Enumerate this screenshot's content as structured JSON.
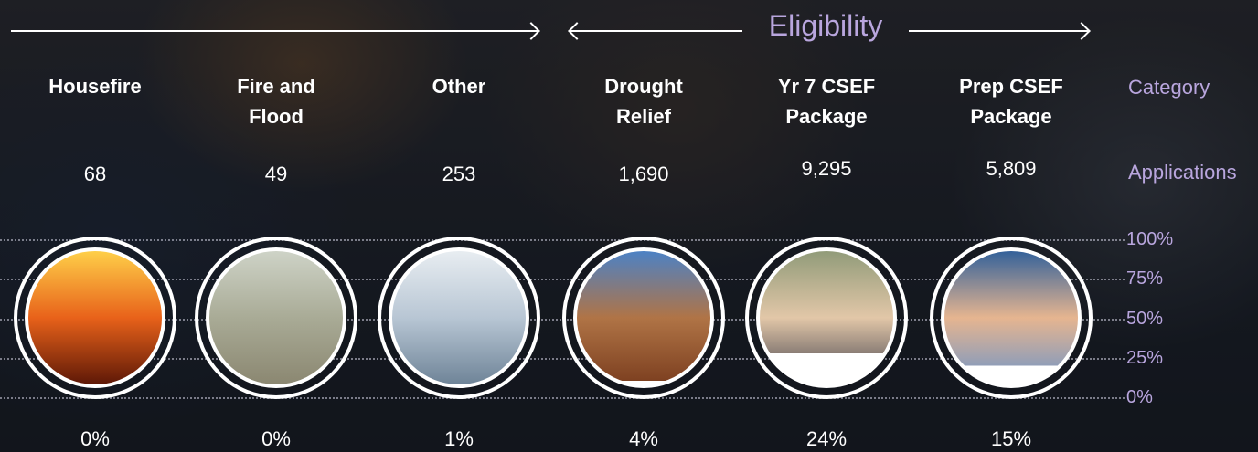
{
  "header": {
    "eligibility_label": "Eligibility"
  },
  "row_labels": {
    "category": "Category",
    "applications": "Applications"
  },
  "colors": {
    "accent": "#b9a6de",
    "text": "#ffffff"
  },
  "icons": [
    "house-fire-image",
    "flood-stop-sign-image",
    "schoolgirl-image",
    "cracked-earth-image",
    "schoolgirl-uniform-image",
    "schoolboy-hat-image"
  ],
  "chart_data": {
    "type": "bar",
    "categories": [
      "Housefire",
      "Fire and Flood",
      "Other",
      "Drought Relief",
      "Yr 7 CSEF Package",
      "Prep CSEF Package"
    ],
    "series": [
      {
        "name": "Applications",
        "values": [
          68,
          49,
          253,
          1690,
          9295,
          5809
        ]
      },
      {
        "values": [
          0,
          0,
          1,
          4,
          24,
          15
        ]
      }
    ],
    "category_lines": [
      [
        "Housefire"
      ],
      [
        "Fire and",
        "Flood"
      ],
      [
        "Other"
      ],
      [
        "Drought",
        "Relief"
      ],
      [
        "Yr 7 CSEF",
        "Package"
      ],
      [
        "Prep CSEF",
        "Package"
      ]
    ],
    "applications_display": [
      "68",
      "49",
      "253",
      "1,690",
      "9,295",
      "5,809"
    ],
    "percent_display": [
      "0%",
      "0%",
      "1%",
      "4%",
      "24%",
      "15%"
    ],
    "y_ticks": [
      "100%",
      "75%",
      "50%",
      "25%",
      "0%"
    ],
    "ylim": [
      0,
      100
    ],
    "grid": true
  }
}
